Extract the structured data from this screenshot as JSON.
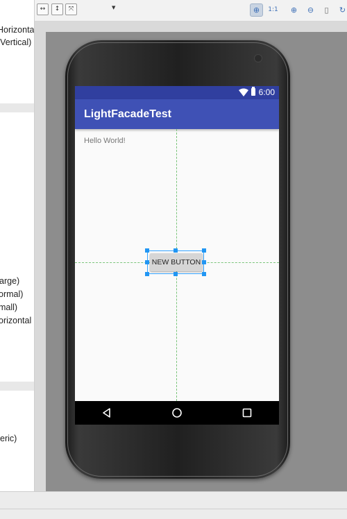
{
  "left_panel": {
    "lines_top": [
      "Horizonta",
      "(Vertical)"
    ],
    "lines_middle": [
      "arge)",
      "ormal)",
      "mall)",
      "orizontal"
    ],
    "lines_bottom": [
      "eric)"
    ]
  },
  "toolbar": {
    "left_icons": [
      "fit-width-icon",
      "fit-height-icon",
      "expand-icon"
    ],
    "zoom_icons": [
      "zoom-to-fit-icon",
      "actual-size-icon",
      "zoom-in-icon",
      "zoom-out-icon",
      "document-icon",
      "refresh-icon"
    ],
    "actual_size_label": "1:1"
  },
  "device": {
    "status_time": "6:00",
    "app_title": "LightFacadeTest",
    "hello_text": "Hello World!",
    "button_label": "NEW BUTTON",
    "colors": {
      "status_bar": "#303f9f",
      "app_bar": "#3f51b5",
      "guides": "#7ac47a",
      "selection": "#33a3ff"
    }
  }
}
